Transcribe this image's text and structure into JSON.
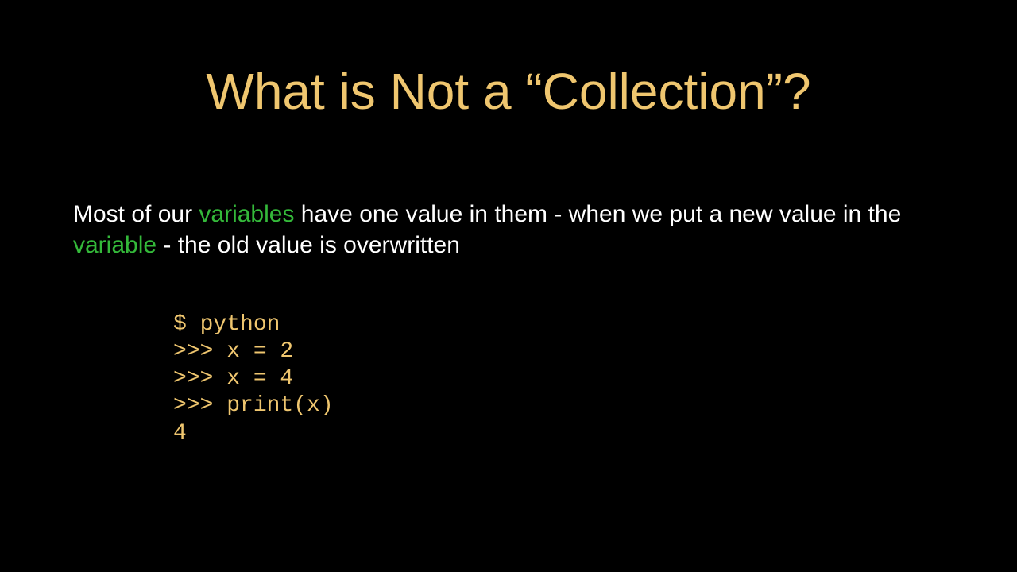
{
  "slide": {
    "title": "What is Not a “Collection”?",
    "body": {
      "seg1": "Most of our ",
      "hl1": "variables",
      "seg2": " have one value in them - when we put a new value in the ",
      "hl2": "variable",
      "seg3": " - the old value is overwritten"
    },
    "code": "$ python\n>>> x = 2\n>>> x = 4\n>>> print(x)\n4"
  }
}
